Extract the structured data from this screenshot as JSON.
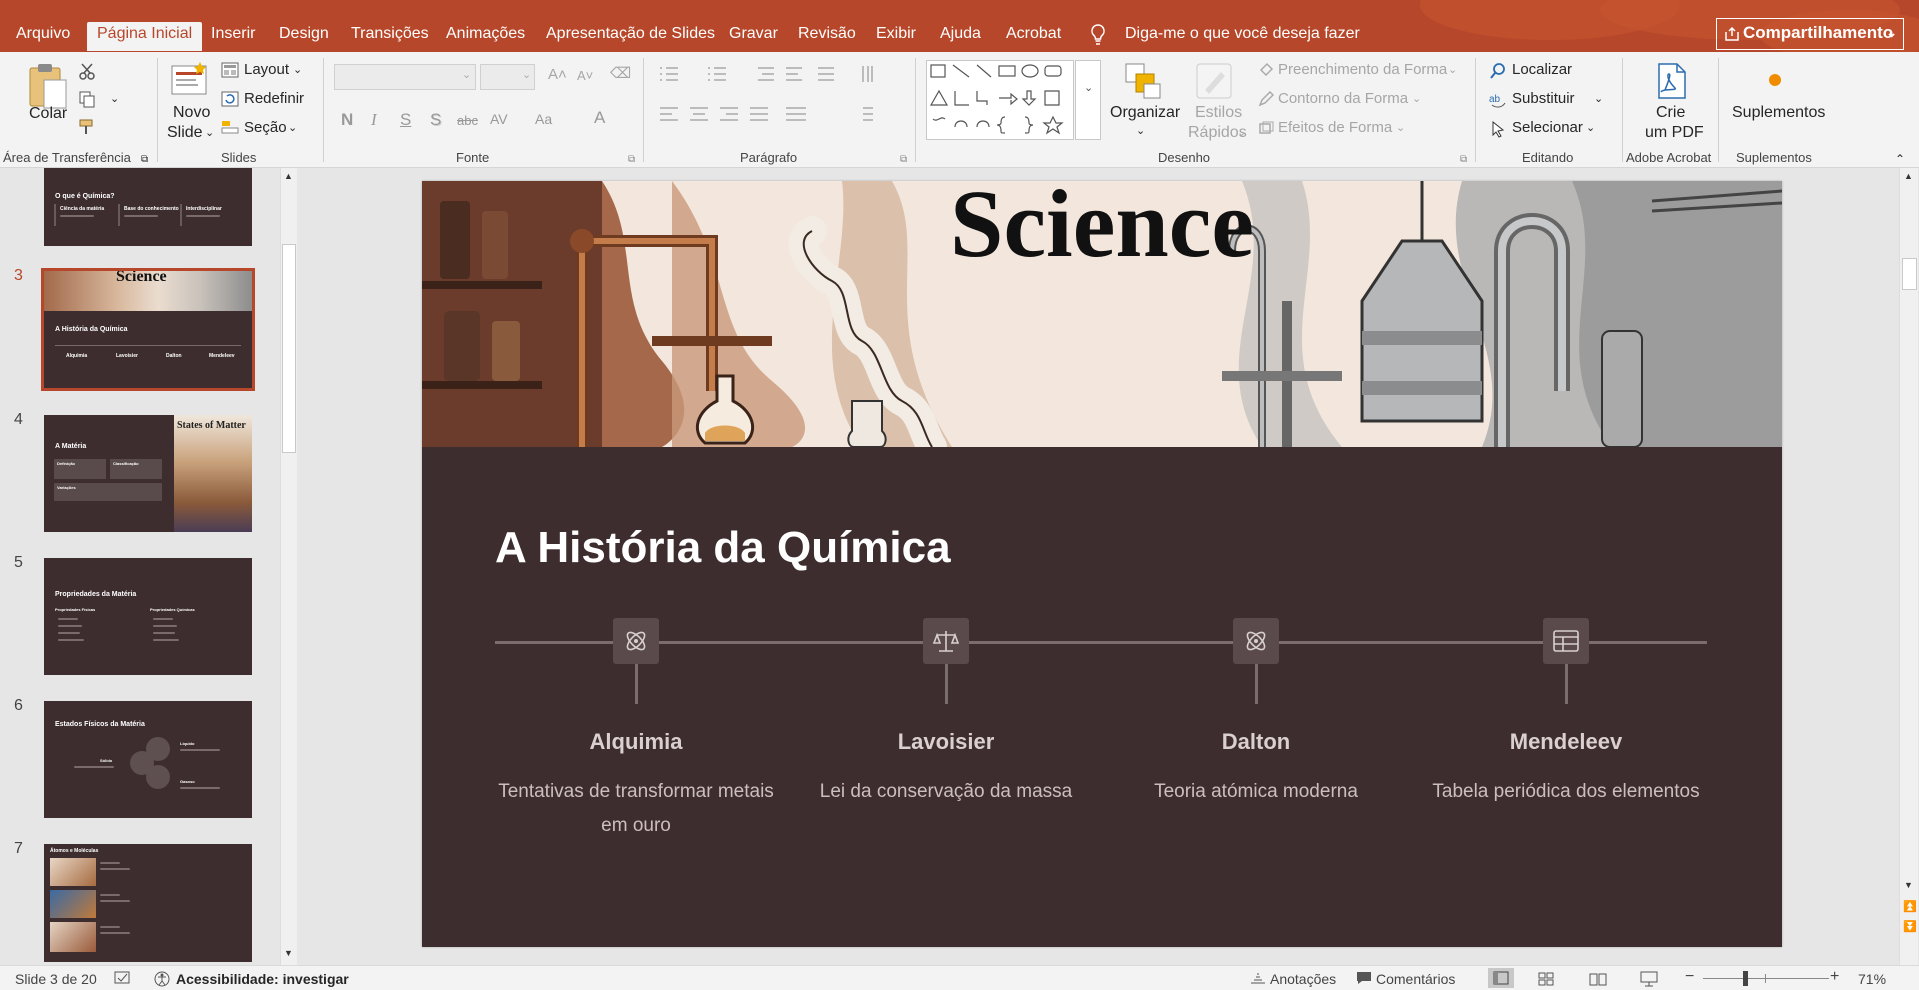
{
  "tabs": [
    {
      "label": "Arquivo",
      "name": "tab-arquivo"
    },
    {
      "label": "Página Inicial",
      "name": "tab-pagina-inicial",
      "active": true
    },
    {
      "label": "Inserir",
      "name": "tab-inserir"
    },
    {
      "label": "Design",
      "name": "tab-design"
    },
    {
      "label": "Transições",
      "name": "tab-transicoes"
    },
    {
      "label": "Animações",
      "name": "tab-animacoes"
    },
    {
      "label": "Apresentação de Slides",
      "name": "tab-apresentacao"
    },
    {
      "label": "Gravar",
      "name": "tab-gravar"
    },
    {
      "label": "Revisão",
      "name": "tab-revisao"
    },
    {
      "label": "Exibir",
      "name": "tab-exibir"
    },
    {
      "label": "Ajuda",
      "name": "tab-ajuda"
    },
    {
      "label": "Acrobat",
      "name": "tab-acrobat"
    }
  ],
  "tellme": "Diga-me o que você deseja fazer",
  "share": "Compartilhamento",
  "ribbon": {
    "clipboard": {
      "paste": "Colar",
      "group": "Área de Transferência"
    },
    "slides": {
      "new_slide_1": "Novo",
      "new_slide_2": "Slide",
      "layout": "Layout",
      "reset": "Redefinir",
      "section": "Seção",
      "group": "Slides"
    },
    "font": {
      "group": "Fonte",
      "bold": "N",
      "italic": "I",
      "underline": "S",
      "shadow": "S",
      "strike": "abc",
      "spacing": "AV",
      "case": "Aa",
      "color": "A"
    },
    "paragraph": {
      "group": "Parágrafo"
    },
    "drawing": {
      "arrange": "Organizar",
      "quick_styles_1": "Estilos",
      "quick_styles_2": "Rápidos",
      "fill": "Preenchimento da Forma",
      "outline": "Contorno da Forma",
      "effects": "Efeitos de Forma",
      "group": "Desenho"
    },
    "editing": {
      "find": "Localizar",
      "replace": "Substituir",
      "select": "Selecionar",
      "group": "Editando"
    },
    "acrobat": {
      "create_1": "Crie",
      "create_2": "um PDF",
      "group": "Adobe Acrobat"
    },
    "addins": {
      "label": "Suplementos",
      "group": "Suplementos"
    }
  },
  "thumbnails": [
    {
      "num": "",
      "title": "O que é Química?",
      "items": [
        "Ciência da matéria",
        "Base do conhecimento",
        "Interdisciplinar"
      ]
    },
    {
      "num": "3",
      "title": "A História da Química",
      "hero": "Science",
      "items": [
        "Alquimia",
        "Lavoisier",
        "Dalton",
        "Mendeleev"
      ]
    },
    {
      "num": "4",
      "title": "A Matéria",
      "image_title": "States of Matter",
      "items": [
        "Definição",
        "Classificação",
        "Variações"
      ]
    },
    {
      "num": "5",
      "title": "Propriedades da Matéria",
      "items": [
        "Propriedades Físicas",
        "Propriedades Químicas"
      ]
    },
    {
      "num": "6",
      "title": "Estados Físicos da Matéria",
      "items": [
        "Sólido",
        "Líquido",
        "Gasoso"
      ]
    },
    {
      "num": "7",
      "title": "Átomos e Moléculas",
      "items": []
    }
  ],
  "slide": {
    "hero_text": "Science",
    "title": "A História da Química",
    "milestones": [
      {
        "icon": "atom-icon",
        "name": "Alquimia",
        "desc": "Tentativas de transformar metais em ouro"
      },
      {
        "icon": "scale-icon",
        "name": "Lavoisier",
        "desc": "Lei da conservação da massa"
      },
      {
        "icon": "atom-icon",
        "name": "Dalton",
        "desc": "Teoria atómica moderna"
      },
      {
        "icon": "table-icon",
        "name": "Mendeleev",
        "desc": "Tabela periódica dos elementos"
      }
    ]
  },
  "status": {
    "slide_count": "Slide 3 de 20",
    "accessibility": "Acessibilidade: investigar",
    "notes": "Anotações",
    "comments": "Comentários",
    "zoom": "71%",
    "zoom_level": 0.71
  },
  "colors": {
    "accent": "#b7472a",
    "slide_bg": "#3d2d2f",
    "node": "#5a4a4b"
  }
}
